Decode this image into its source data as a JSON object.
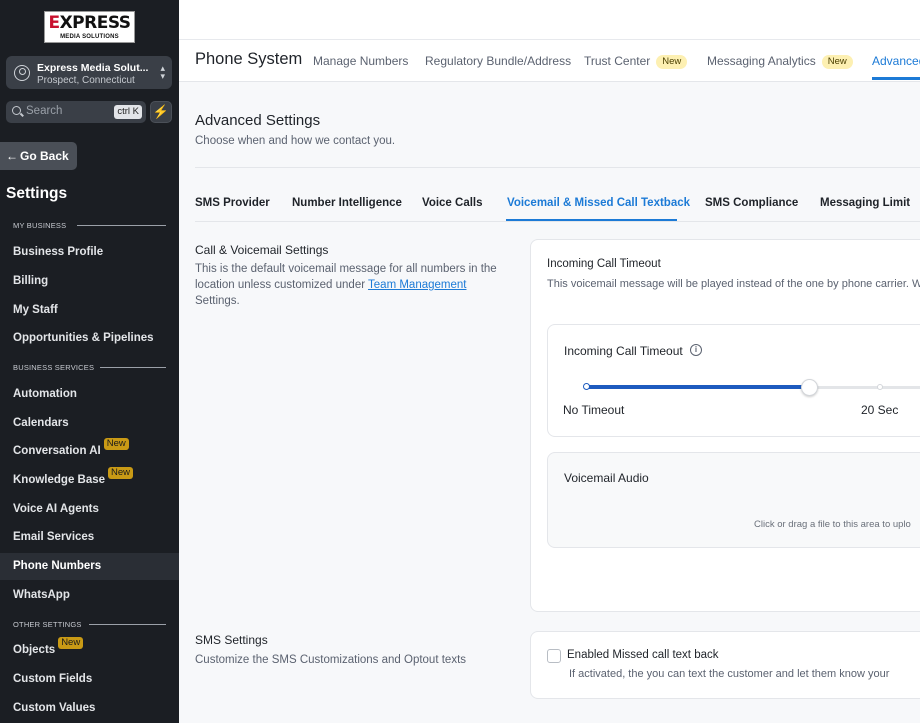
{
  "sidebar": {
    "logo": {
      "line1_a": "E",
      "line1_b": "XPRESS",
      "line2": "MEDIA SOLUTIONS"
    },
    "account": {
      "name": "Express Media Solut...",
      "location": "Prospect, Connecticut"
    },
    "search": {
      "placeholder": "Search",
      "shortcut": "ctrl K"
    },
    "go_back": "Go Back",
    "title": "Settings",
    "sections": {
      "my_business": "MY BUSINESS",
      "business_services": "BUSINESS SERVICES",
      "other_settings": "OTHER SETTINGS"
    },
    "items": {
      "business_profile": "Business Profile",
      "billing": "Billing",
      "my_staff": "My Staff",
      "opportunities": "Opportunities & Pipelines",
      "automation": "Automation",
      "calendars": "Calendars",
      "conversation_ai": "Conversation AI",
      "knowledge_base": "Knowledge Base",
      "voice_ai_agents": "Voice AI Agents",
      "email_services": "Email Services",
      "phone_numbers": "Phone Numbers",
      "whatsapp": "WhatsApp",
      "objects": "Objects",
      "custom_fields": "Custom Fields",
      "custom_values": "Custom Values"
    },
    "new_badge": "New",
    "accent": "#c99a15"
  },
  "header": {
    "title": "Phone System",
    "tabs": {
      "manage_numbers": "Manage Numbers",
      "regulatory": "Regulatory Bundle/Address",
      "trust_center": "Trust Center",
      "messaging_analytics": "Messaging Analytics",
      "advanced": "Advanced"
    },
    "new_badge": "New"
  },
  "main": {
    "title": "Advanced Settings",
    "subtitle": "Choose when and how we contact you.",
    "tabs": {
      "sms_provider": "SMS Provider",
      "number_intelligence": "Number Intelligence",
      "voice_calls": "Voice Calls",
      "voicemail": "Voicemail & Missed Call Textback",
      "sms_compliance": "SMS Compliance",
      "messaging_limit": "Messaging Limit"
    },
    "call_section": {
      "title": "Call & Voicemail Settings",
      "desc_before": "This is the default voicemail message for all numbers in the location unless customized under ",
      "link": "Team Management",
      "desc_after": " Settings."
    },
    "card": {
      "title": "Incoming Call Timeout",
      "desc": "This voicemail message will be played instead of the one by phone carrier. W",
      "timeout": {
        "title": "Incoming Call Timeout",
        "info_icon": "i",
        "label_start": "No Timeout",
        "label_mid": "20 Sec",
        "level_percent": 67
      },
      "voicemail_audio": {
        "title": "Voicemail Audio",
        "hint": "Click or drag a file to this area to uplo"
      }
    },
    "sms_section": {
      "title": "SMS Settings",
      "desc": "Customize the SMS Customizations and Optout texts",
      "checkbox_label": "Enabled Missed call text back",
      "checkbox_desc": "If activated, the you can text the customer and let them know your",
      "checked": false
    },
    "accent": "#1c7ad6"
  }
}
